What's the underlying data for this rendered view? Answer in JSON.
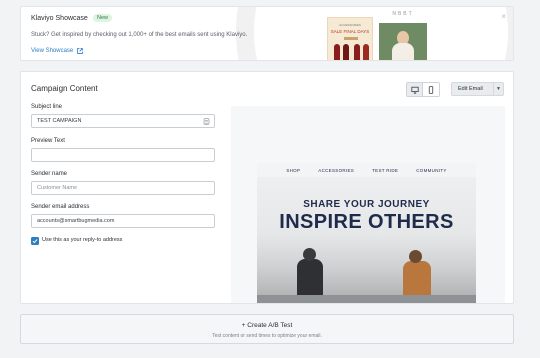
{
  "showcase": {
    "title": "Klaviyo Showcase",
    "badge": "New",
    "description": "Stuck? Get inspired by checking out 1,000+ of the best emails sent using Klaviyo.",
    "link": "View Showcase",
    "close": "×",
    "thumb1": {
      "brand": "ACCESSORIES",
      "sale": "SALE FINAL DAYS"
    },
    "thumb2": {
      "logo": "NBBT"
    }
  },
  "campaign": {
    "title": "Campaign Content",
    "edit_email": "Edit Email",
    "subject": {
      "label": "Subject line",
      "value": "TEST CAMPAIGN"
    },
    "preview_text": {
      "label": "Preview Text",
      "value": ""
    },
    "sender_name": {
      "label": "Sender name",
      "placeholder": "Customer Name"
    },
    "sender_email": {
      "label": "Sender email address",
      "value": "accounts@smartbugmedia.com"
    },
    "reply_to": {
      "label": "Use this as your reply-to address",
      "checked": true
    }
  },
  "email_preview": {
    "nav": [
      "SHOP",
      "ACCESSORIES",
      "TEST RIDE",
      "COMMUNITY"
    ],
    "headline_small": "SHARE YOUR JOURNEY",
    "headline_large": "INSPIRE OTHERS"
  },
  "ab_test": {
    "title": "+ Create A/B Test",
    "subtitle": "Test content or send times to optimize your email."
  },
  "colors": {
    "accent": "#2d7ec4",
    "badge_bg": "#dff3e2",
    "navy": "#1f2b4a"
  }
}
